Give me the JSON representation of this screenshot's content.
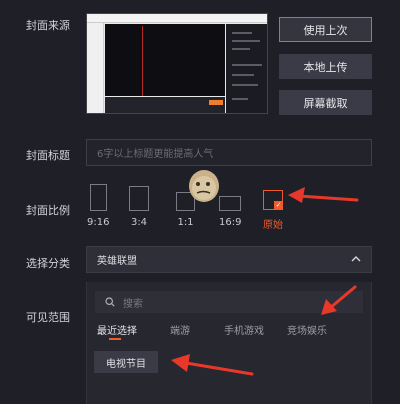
{
  "labels": {
    "cover_source": "封面来源",
    "cover_title": "封面标题",
    "cover_ratio": "封面比例",
    "category": "选择分类",
    "visibility": "可见范围"
  },
  "buttons": {
    "use_last": "使用上次",
    "local_upload": "本地上传",
    "screenshot": "屏幕截取"
  },
  "title_input": {
    "placeholder": "6字以上标题更能提高人气"
  },
  "ratios": [
    {
      "label": "9:16",
      "selected": false
    },
    {
      "label": "3:4",
      "selected": false
    },
    {
      "label": "1:1",
      "selected": false
    },
    {
      "label": "16:9",
      "selected": false
    },
    {
      "label": "原始",
      "selected": true
    }
  ],
  "category": {
    "selected": "英雄联盟"
  },
  "visibility": {
    "search_placeholder": "搜索",
    "tabs": [
      "最近选择",
      "端游",
      "手机游戏",
      "竞场娱乐"
    ],
    "active_tab": "最近选择",
    "chips": [
      "电视节目"
    ]
  },
  "colors": {
    "accent": "#f05a2c",
    "annotation_arrow": "#e8382a",
    "background": "#1f1f27"
  }
}
